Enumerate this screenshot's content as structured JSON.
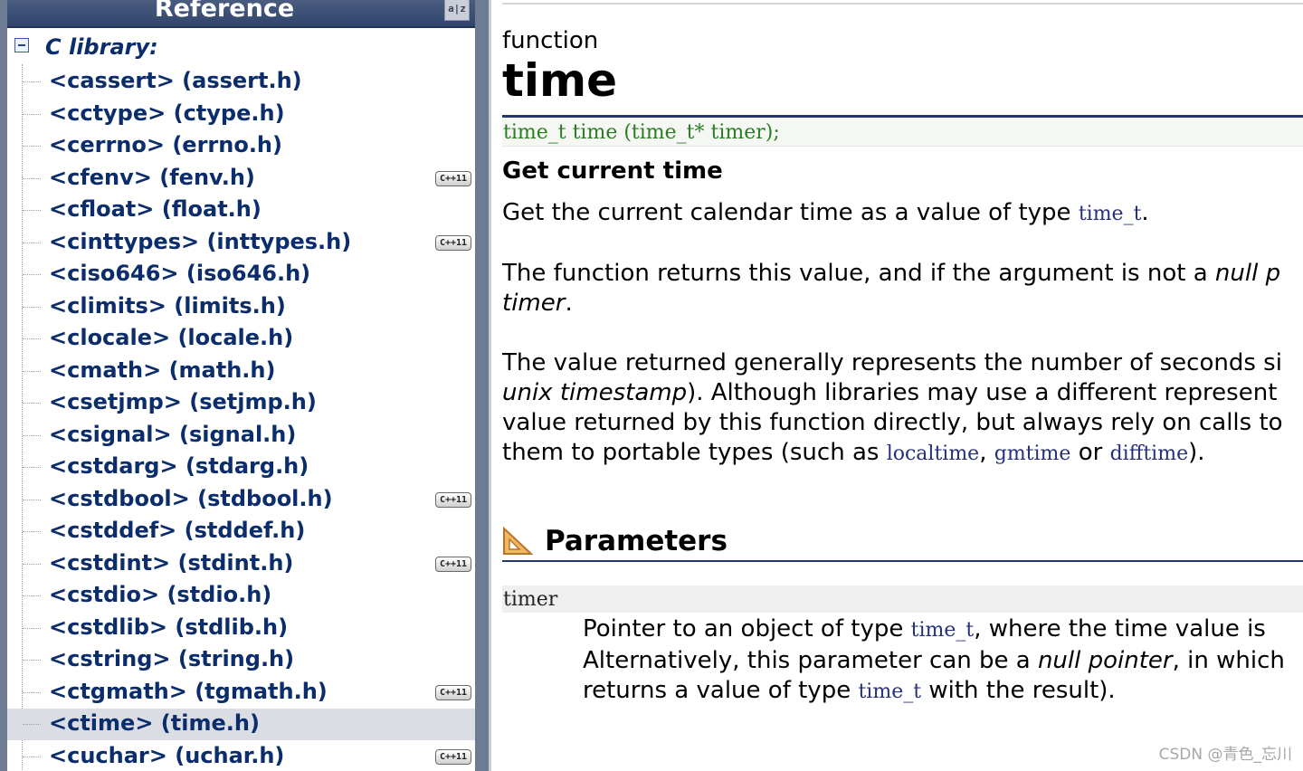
{
  "sidebar": {
    "title": "Reference",
    "az_icon": "a|z",
    "root": "C library:",
    "badge_text": "C++11",
    "items": [
      {
        "label": "<cassert> (assert.h)",
        "cpp11": false,
        "selected": false
      },
      {
        "label": "<cctype> (ctype.h)",
        "cpp11": false,
        "selected": false
      },
      {
        "label": "<cerrno> (errno.h)",
        "cpp11": false,
        "selected": false
      },
      {
        "label": "<cfenv> (fenv.h)",
        "cpp11": true,
        "selected": false
      },
      {
        "label": "<cfloat> (float.h)",
        "cpp11": false,
        "selected": false
      },
      {
        "label": "<cinttypes> (inttypes.h)",
        "cpp11": true,
        "selected": false
      },
      {
        "label": "<ciso646> (iso646.h)",
        "cpp11": false,
        "selected": false
      },
      {
        "label": "<climits> (limits.h)",
        "cpp11": false,
        "selected": false
      },
      {
        "label": "<clocale> (locale.h)",
        "cpp11": false,
        "selected": false
      },
      {
        "label": "<cmath> (math.h)",
        "cpp11": false,
        "selected": false
      },
      {
        "label": "<csetjmp> (setjmp.h)",
        "cpp11": false,
        "selected": false
      },
      {
        "label": "<csignal> (signal.h)",
        "cpp11": false,
        "selected": false
      },
      {
        "label": "<cstdarg> (stdarg.h)",
        "cpp11": false,
        "selected": false
      },
      {
        "label": "<cstdbool> (stdbool.h)",
        "cpp11": true,
        "selected": false
      },
      {
        "label": "<cstddef> (stddef.h)",
        "cpp11": false,
        "selected": false
      },
      {
        "label": "<cstdint> (stdint.h)",
        "cpp11": true,
        "selected": false
      },
      {
        "label": "<cstdio> (stdio.h)",
        "cpp11": false,
        "selected": false
      },
      {
        "label": "<cstdlib> (stdlib.h)",
        "cpp11": false,
        "selected": false
      },
      {
        "label": "<cstring> (string.h)",
        "cpp11": false,
        "selected": false
      },
      {
        "label": "<ctgmath> (tgmath.h)",
        "cpp11": true,
        "selected": false
      },
      {
        "label": "<ctime> (time.h)",
        "cpp11": false,
        "selected": true
      },
      {
        "label": "<cuchar> (uchar.h)",
        "cpp11": true,
        "selected": false
      }
    ]
  },
  "main": {
    "kind": "function",
    "name": "time",
    "prototype": "time_t time (time_t* timer);",
    "subtitle": "Get current time",
    "p1": {
      "text": "Get the current calendar time as a value of type ",
      "code": "time_t",
      "end": "."
    },
    "p2": {
      "line1_a": "The function returns this value, and if the argument is not a ",
      "line1_em": "null p",
      "line2_em": "timer",
      "line2_end": "."
    },
    "p3": {
      "line1": "The value returned generally represents the number of seconds si",
      "line2_em": "unix timestamp",
      "line2_rest": "). Although libraries may use a different represent",
      "line3": "value returned by this function directly, but always rely on calls to",
      "line4_a": "them to portable types (such as ",
      "code1": "localtime",
      "sep1": ", ",
      "code2": "gmtime",
      "sep2": " or ",
      "code3": "difftime",
      "line4_end": ")."
    },
    "parameters": {
      "title": "Parameters",
      "param_name": "timer",
      "desc_line1_a": "Pointer to an object of type ",
      "desc_code1": "time_t",
      "desc_line1_b": ", where the time value is",
      "desc_line2_a": "Alternatively, this parameter can be a ",
      "desc_line2_em": "null pointer",
      "desc_line2_b": ", in which",
      "desc_line3_a": "returns a value of type ",
      "desc_code2": "time_t",
      "desc_line3_b": " with the result)."
    }
  },
  "watermark": "CSDN @青色_忘川",
  "colors": {
    "link_dark": "#0c2d6b",
    "prototype_green": "#2a7d23",
    "code_blue": "#27307a",
    "header_bar": "#31446b"
  }
}
